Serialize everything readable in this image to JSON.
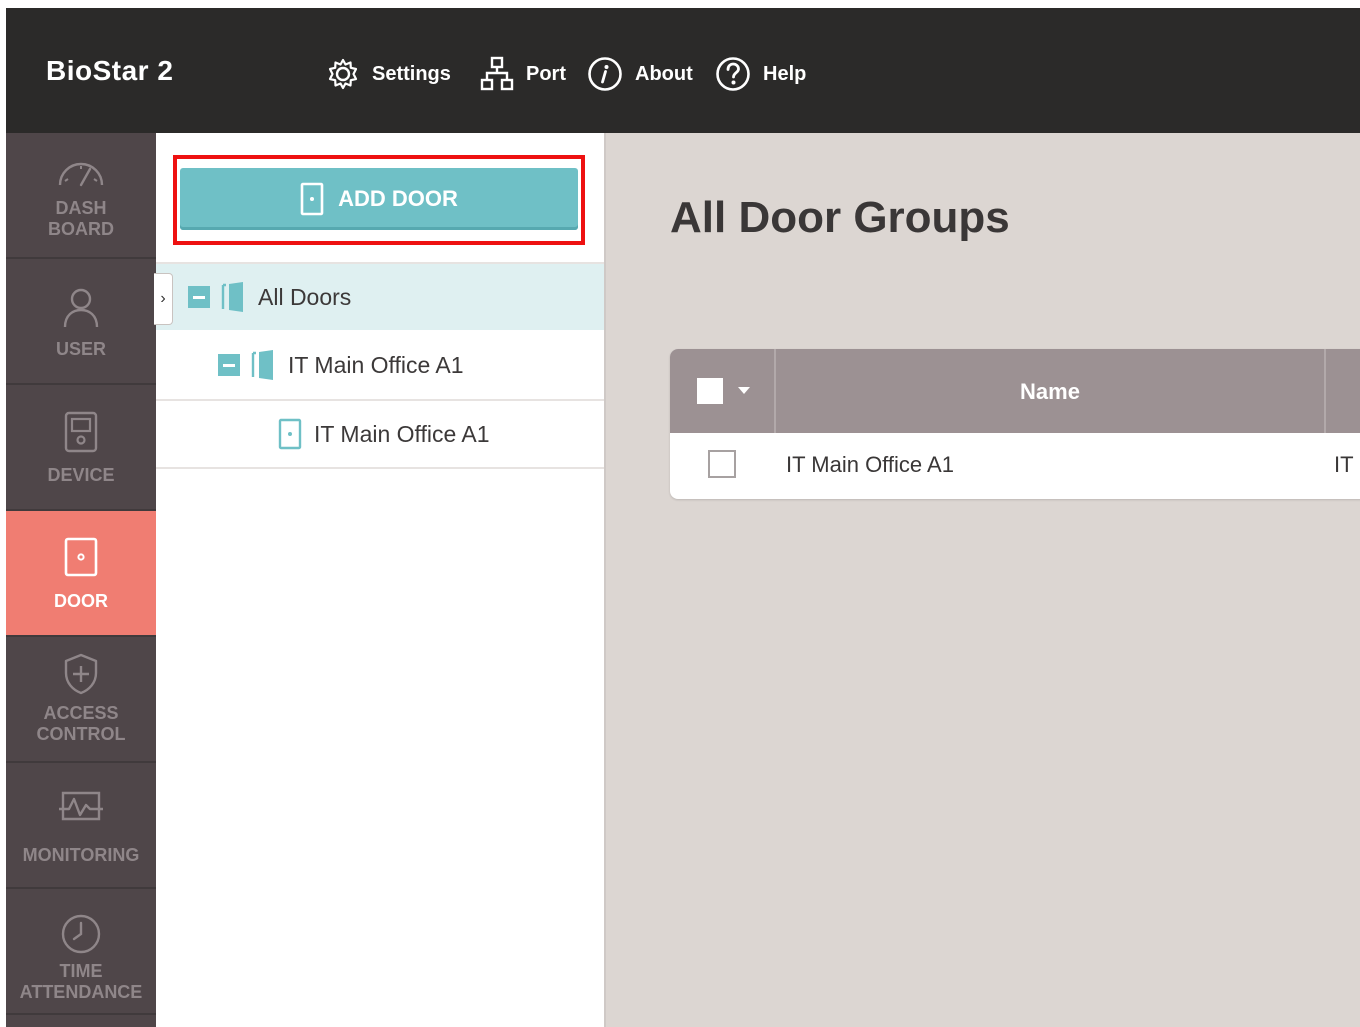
{
  "app": {
    "title": "BioStar 2"
  },
  "top_menu": [
    {
      "label": "Settings",
      "icon": "gear-icon"
    },
    {
      "label": "Port",
      "icon": "network-icon"
    },
    {
      "label": "About",
      "icon": "info-icon"
    },
    {
      "label": "Help",
      "icon": "help-icon"
    }
  ],
  "sidebar": {
    "items": [
      {
        "label": "DASH\nBOARD",
        "icon": "gauge-icon",
        "active": false
      },
      {
        "label": "USER",
        "icon": "user-icon",
        "active": false
      },
      {
        "label": "DEVICE",
        "icon": "device-icon",
        "active": false
      },
      {
        "label": "DOOR",
        "icon": "door-icon",
        "active": true
      },
      {
        "label": "ACCESS\nCONTROL",
        "icon": "shield-plus-icon",
        "active": false
      },
      {
        "label": "MONITORING",
        "icon": "monitor-pulse-icon",
        "active": false
      },
      {
        "label": "TIME\nATTENDANCE",
        "icon": "clock-icon",
        "active": false
      }
    ]
  },
  "tree": {
    "add_button_label": "ADD DOOR",
    "nodes": [
      {
        "label": "All Doors",
        "type": "group",
        "selected": true
      },
      {
        "label": "IT Main Office A1",
        "type": "group",
        "selected": false
      },
      {
        "label": "IT Main Office A1",
        "type": "door",
        "selected": false
      }
    ]
  },
  "main": {
    "title": "All Door Groups",
    "table": {
      "columns": [
        "Name"
      ],
      "rows": [
        {
          "name": "IT Main Office A1",
          "group": "IT"
        }
      ]
    }
  },
  "colors": {
    "topbar": "#2b2a29",
    "sidebar": "#4f4649",
    "active_nav": "#f07d72",
    "accent_teal": "#6fc0c6",
    "highlight_border": "#ee1111",
    "table_header": "#9c9193"
  }
}
